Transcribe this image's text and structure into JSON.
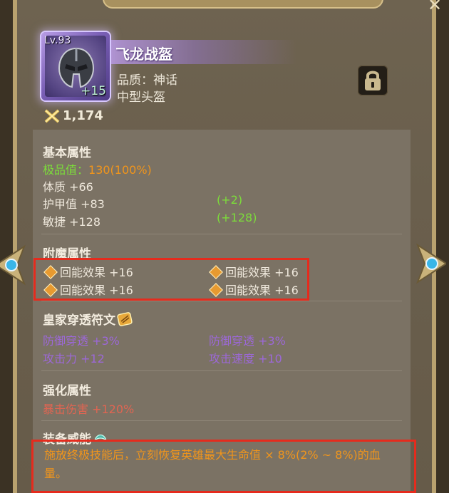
{
  "item": {
    "level": "Lv.93",
    "enhance": "+15",
    "name": "飞龙战盔",
    "quality": "品质：神话",
    "type": "中型头盔",
    "power": "1,174"
  },
  "base": {
    "title": "基本属性",
    "extreme_label": "极品值：",
    "extreme_value": "130(100%)",
    "stats": [
      {
        "label": "体质 +66",
        "bonus": ""
      },
      {
        "label": "护甲值 +83",
        "bonus": "(+2)"
      },
      {
        "label": "敏捷 +128",
        "bonus": "(+128)"
      }
    ]
  },
  "enchant": {
    "title": "附魔属性",
    "stats": [
      "回能效果 +16",
      "回能效果 +16",
      "回能效果 +16",
      "回能效果 +16"
    ]
  },
  "royal": {
    "title": "皇家穿透符文",
    "stats": [
      "防御穿透 +3%",
      "防御穿透 +3%",
      "攻击力 +12",
      "攻击速度 +10"
    ]
  },
  "enhance": {
    "title": "强化属性",
    "stat": "暴击伤害 +120%"
  },
  "equip_skill": {
    "title": "装备威能",
    "text": "施放终极技能后，立刻恢复英雄最大生命值 × 8%(2% ~ 8%)的血量。"
  },
  "colors": {
    "green": "#7cdd3a",
    "orange": "#f0951c",
    "purple": "#9c68d8",
    "red": "#e06552",
    "highlight": "#e52b1d"
  }
}
